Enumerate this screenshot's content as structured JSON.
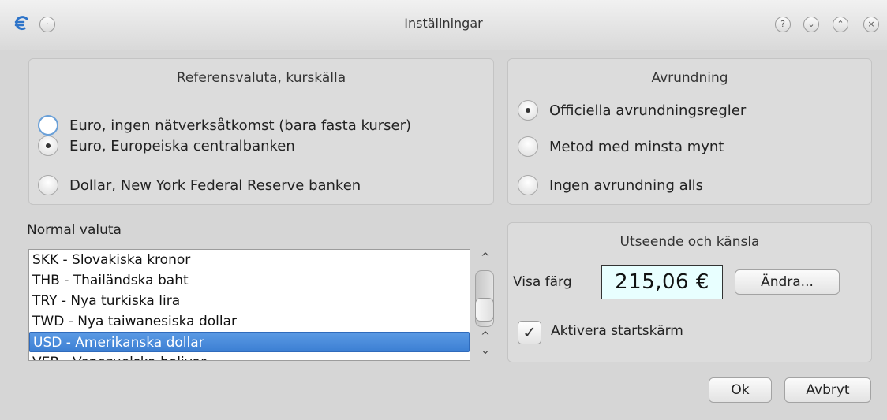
{
  "window": {
    "title": "Inställningar",
    "buttons": [
      "?",
      "⌄",
      "⌃",
      "×"
    ]
  },
  "reference_group": {
    "title": "Referensvaluta, kurskälla",
    "options": [
      {
        "label": "Euro, ingen nätverksåtkomst (bara fasta kurser)",
        "selected": false
      },
      {
        "label": "Euro, Europeiska centralbanken",
        "selected": true
      },
      {
        "label": "Dollar, New York Federal Reserve banken",
        "selected": false
      }
    ]
  },
  "rounding_group": {
    "title": "Avrundning",
    "options": [
      {
        "label": "Officiella avrundningsregler",
        "selected": true
      },
      {
        "label": "Metod med minsta mynt",
        "selected": false
      },
      {
        "label": "Ingen avrundning alls",
        "selected": false
      }
    ]
  },
  "normal_currency": {
    "label": "Normal valuta",
    "items": [
      "SKK - Slovakiska kronor",
      "THB - Thailändska baht",
      "TRY - Nya turkiska lira",
      "TWD - Nya taiwanesiska dollar",
      "USD - Amerikanska dollar",
      "VEB - Venezuelska bolivar"
    ],
    "selected": "USD - Amerikanska dollar"
  },
  "appearance_group": {
    "title": "Utseende och känsla",
    "color_label": "Visa färg",
    "color_sample": "215,06 €",
    "color_sample_bg": "#e8ffff",
    "change_button": "Ändra...",
    "splash_label": "Aktivera startskärm",
    "splash_checked": true
  },
  "footer": {
    "ok": "Ok",
    "cancel": "Avbryt"
  }
}
